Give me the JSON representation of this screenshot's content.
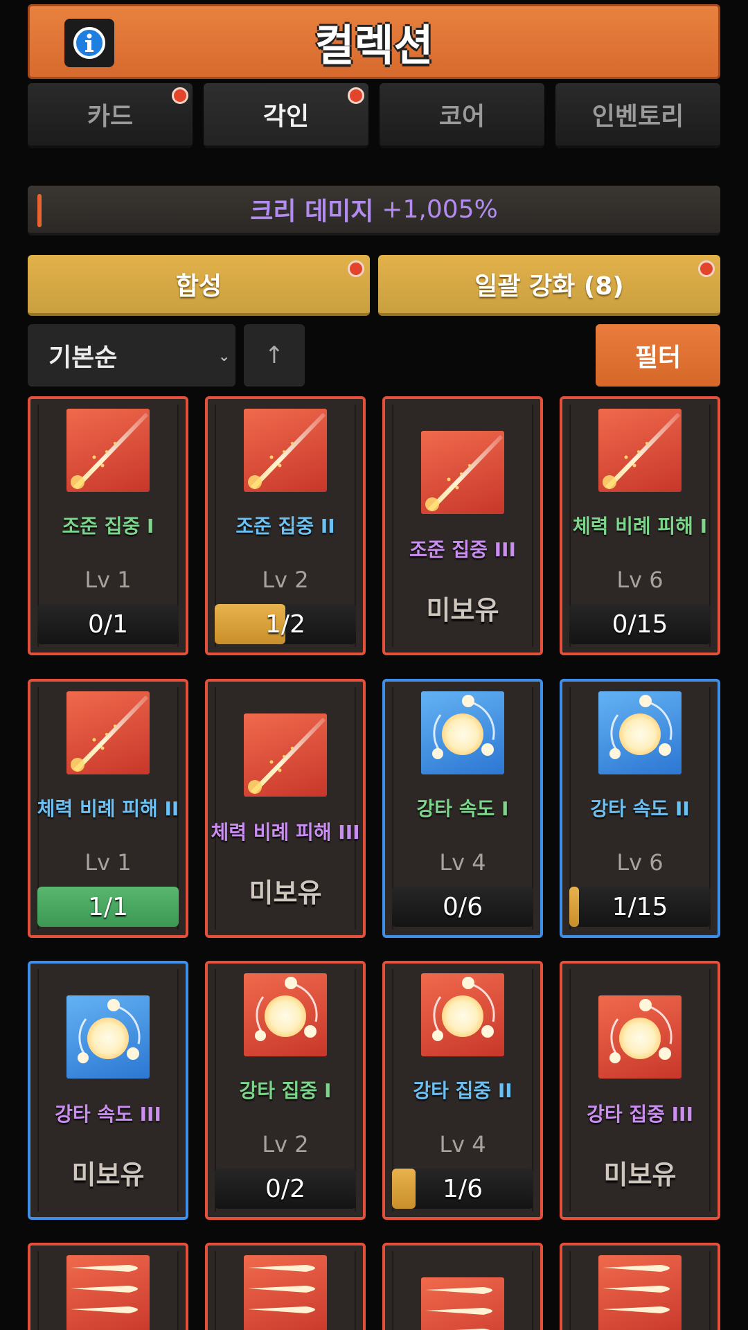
{
  "header": {
    "title": "컬렉션",
    "info_icon": "info-icon"
  },
  "tabs": [
    {
      "label": "카드",
      "badge": true
    },
    {
      "label": "각인",
      "badge": true,
      "active": true
    },
    {
      "label": "코어",
      "badge": false
    },
    {
      "label": "인벤토리",
      "badge": false
    }
  ],
  "stat": {
    "label": "크리 데미지",
    "value": "+1,005%"
  },
  "actions": {
    "synthesize": "합성",
    "bulk_upgrade": "일괄 강화 (8)"
  },
  "sort": {
    "selected": "기본순",
    "direction_icon": "↑",
    "filter": "필터"
  },
  "colors": {
    "accent_orange": "#e9642e",
    "rarity_red": "#e4503a",
    "rarity_blue": "#3f8fe8",
    "gold": "#e2b14a"
  },
  "cards": [
    {
      "name": "조준 집중 I",
      "icon": "streak-icon",
      "level": "Lv 1",
      "progress": "0/1",
      "fill": 0
    },
    {
      "name": "조준 집중 II",
      "icon": "streak-icon",
      "level": "Lv 2",
      "progress": "1/2",
      "fill": 0.5
    },
    {
      "name": "조준 집중 III",
      "icon": "streak-icon",
      "unowned": "미보유"
    },
    {
      "name": "체력 비례 피해 I",
      "icon": "streak-icon",
      "level": "Lv 6",
      "progress": "0/15",
      "fill": 0
    },
    {
      "name": "체력 비례 피해 II",
      "icon": "streak-icon",
      "level": "Lv 1",
      "progress": "1/1",
      "fill": 1
    },
    {
      "name": "체력 비례 피해 III",
      "icon": "streak-icon",
      "unowned": "미보유"
    },
    {
      "name": "강타 속도 I",
      "icon": "orbit-icon",
      "level": "Lv 4",
      "progress": "0/6",
      "fill": 0
    },
    {
      "name": "강타 속도 II",
      "icon": "orbit-icon",
      "level": "Lv 6",
      "progress": "1/15",
      "fill": 0.067
    },
    {
      "name": "강타 속도 III",
      "icon": "orbit-icon",
      "unowned": "미보유"
    },
    {
      "name": "강타 집중 I",
      "icon": "orbit-icon",
      "level": "Lv 2",
      "progress": "0/2",
      "fill": 0
    },
    {
      "name": "강타 집중 II",
      "icon": "orbit-icon",
      "level": "Lv 4",
      "progress": "1/6",
      "fill": 0.167
    },
    {
      "name": "강타 집중 III",
      "icon": "orbit-icon",
      "unowned": "미보유"
    },
    {
      "icon": "triple-bullet-icon"
    },
    {
      "icon": "triple-bullet-icon"
    },
    {
      "icon": "triple-bullet-icon"
    },
    {
      "icon": "triple-bullet-icon"
    }
  ]
}
